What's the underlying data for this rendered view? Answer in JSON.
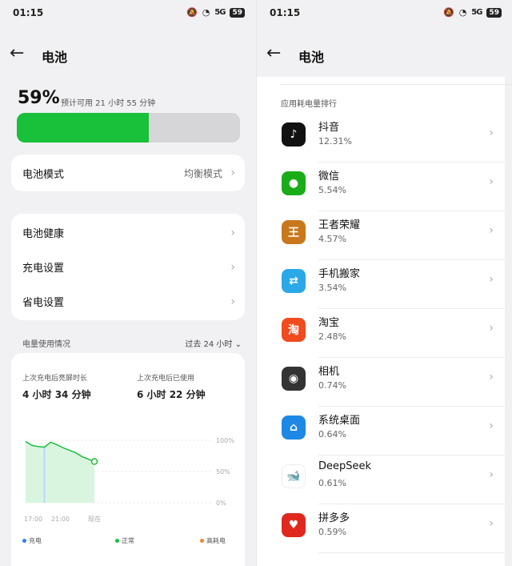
{
  "status": {
    "time": "01:15",
    "battery": "59",
    "signal": "5G"
  },
  "left": {
    "title": "电池",
    "battery_percent_text": "59%",
    "battery_level": 0.59,
    "estimate": "预计可用 21 小时 55 分钟",
    "mode": {
      "label": "电池模式",
      "value": "均衡模式"
    },
    "settings": [
      "电池健康",
      "充电设置",
      "省电设置"
    ],
    "usage": {
      "section_label": "电量使用情况",
      "range": "过去 24 小时",
      "screen_label": "上次充电后亮屏时长",
      "screen_value": "4 小时 34 分钟",
      "used_label": "上次充电后已使用",
      "used_value": "6 小时 22 分钟",
      "y_ticks": [
        "100%",
        "50%",
        "0%"
      ],
      "x_ticks": [
        "17:00",
        "21:00",
        "现在"
      ],
      "legend": [
        {
          "label": "充电",
          "color": "#2d7ff9"
        },
        {
          "label": "正常",
          "color": "#19c03a"
        },
        {
          "label": "高耗电",
          "color": "#f08a1c"
        }
      ]
    }
  },
  "chart_data": {
    "type": "area",
    "x": [
      "17:00",
      "",
      "",
      "",
      "21:00",
      "",
      "",
      "",
      "",
      "",
      "",
      "现在"
    ],
    "series": [
      {
        "values": [
          98,
          92,
          90,
          89,
          97,
          93,
          88,
          84,
          80,
          74,
          70,
          66
        ]
      }
    ],
    "ylim": [
      0,
      100
    ],
    "y_ticks": [
      "100%",
      "50%",
      "0%"
    ]
  },
  "right": {
    "title": "电池",
    "section_label": "应用耗电量排行",
    "apps": [
      {
        "name": "抖音",
        "pct": "12.31%",
        "icon": "douyin-icon",
        "color": "#111111",
        "glyph": "♪"
      },
      {
        "name": "微信",
        "pct": "5.54%",
        "icon": "wechat-icon",
        "color": "#1aad19",
        "glyph": "●"
      },
      {
        "name": "王者荣耀",
        "pct": "4.57%",
        "icon": "honor-of-kings-icon",
        "color": "#c8781c",
        "glyph": "王"
      },
      {
        "name": "手机搬家",
        "pct": "3.54%",
        "icon": "phone-clone-icon",
        "color": "#2aa8e8",
        "glyph": "⇄"
      },
      {
        "name": "淘宝",
        "pct": "2.48%",
        "icon": "taobao-icon",
        "color": "#f04a1e",
        "glyph": "淘"
      },
      {
        "name": "相机",
        "pct": "0.74%",
        "icon": "camera-icon",
        "color": "#333333",
        "glyph": "◉"
      },
      {
        "name": "系统桌面",
        "pct": "0.64%",
        "icon": "system-launcher-icon",
        "color": "#1e88e5",
        "glyph": "⌂"
      },
      {
        "name": "DeepSeek",
        "pct": "0.61%",
        "icon": "deepseek-icon",
        "color": "#ffffff",
        "glyph": "🐋"
      },
      {
        "name": "拼多多",
        "pct": "0.59%",
        "icon": "pinduoduo-icon",
        "color": "#e0281f",
        "glyph": "♥"
      }
    ]
  }
}
